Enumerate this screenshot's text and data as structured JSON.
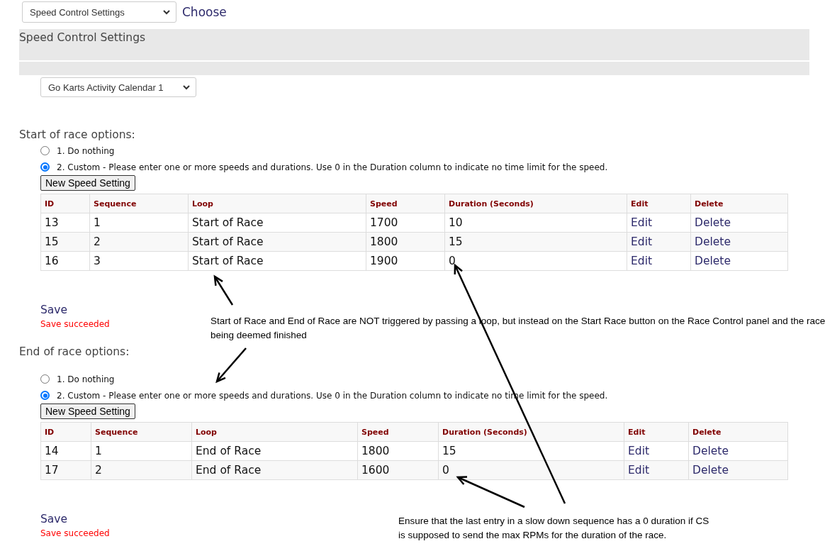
{
  "page_select": {
    "value": "Speed Control Settings"
  },
  "choose_link": "Choose",
  "panel": {
    "title": "Speed Control Settings"
  },
  "calendar_select": {
    "value": "Go Karts Activity Calendar 1"
  },
  "sections": [
    {
      "heading": "Start of race options:",
      "options": [
        {
          "label": "1. Do nothing",
          "selected": false
        },
        {
          "label": "2. Custom - Please enter one or more speeds and durations. Use 0 in the Duration column to indicate no time limit for the speed.",
          "selected": true
        }
      ],
      "button": "New Speed Setting",
      "table": {
        "columns": [
          "ID",
          "Sequence",
          "Loop",
          "Speed",
          "Duration (Seconds)",
          "Edit",
          "Delete"
        ],
        "rows": [
          [
            "13",
            "1",
            "Start of Race",
            "1700",
            "10",
            "Edit",
            "Delete"
          ],
          [
            "15",
            "2",
            "Start of Race",
            "1800",
            "15",
            "Edit",
            "Delete"
          ],
          [
            "16",
            "3",
            "Start of Race",
            "1900",
            "0",
            "Edit",
            "Delete"
          ]
        ]
      },
      "save": "Save",
      "status": "Save succeeded"
    },
    {
      "heading": "End of race options:",
      "options": [
        {
          "label": "1. Do nothing",
          "selected": false
        },
        {
          "label": "2. Custom - Please enter one or more speeds and durations. Use 0 in the Duration column to indicate no time limit for the speed.",
          "selected": true
        }
      ],
      "button": "New Speed Setting",
      "table": {
        "columns": [
          "ID",
          "Sequence",
          "Loop",
          "Speed",
          "Duration (Seconds)",
          "Edit",
          "Delete"
        ],
        "rows": [
          [
            "14",
            "1",
            "End of Race",
            "1800",
            "15",
            "Edit",
            "Delete"
          ],
          [
            "17",
            "2",
            "End of Race",
            "1600",
            "0",
            "Edit",
            "Delete"
          ]
        ]
      },
      "save": "Save",
      "status": "Save succeeded"
    }
  ],
  "annotations": [
    {
      "text": "Start of Race and End of Race are NOT triggered by passing a loop, but instead on the Start Race button on the Race Control panel and the race being deemed finished"
    },
    {
      "text": "Ensure that the last entry in a slow down sequence has a 0 duration if CS is supposed to send the max RPMs for the duration of the race."
    }
  ]
}
